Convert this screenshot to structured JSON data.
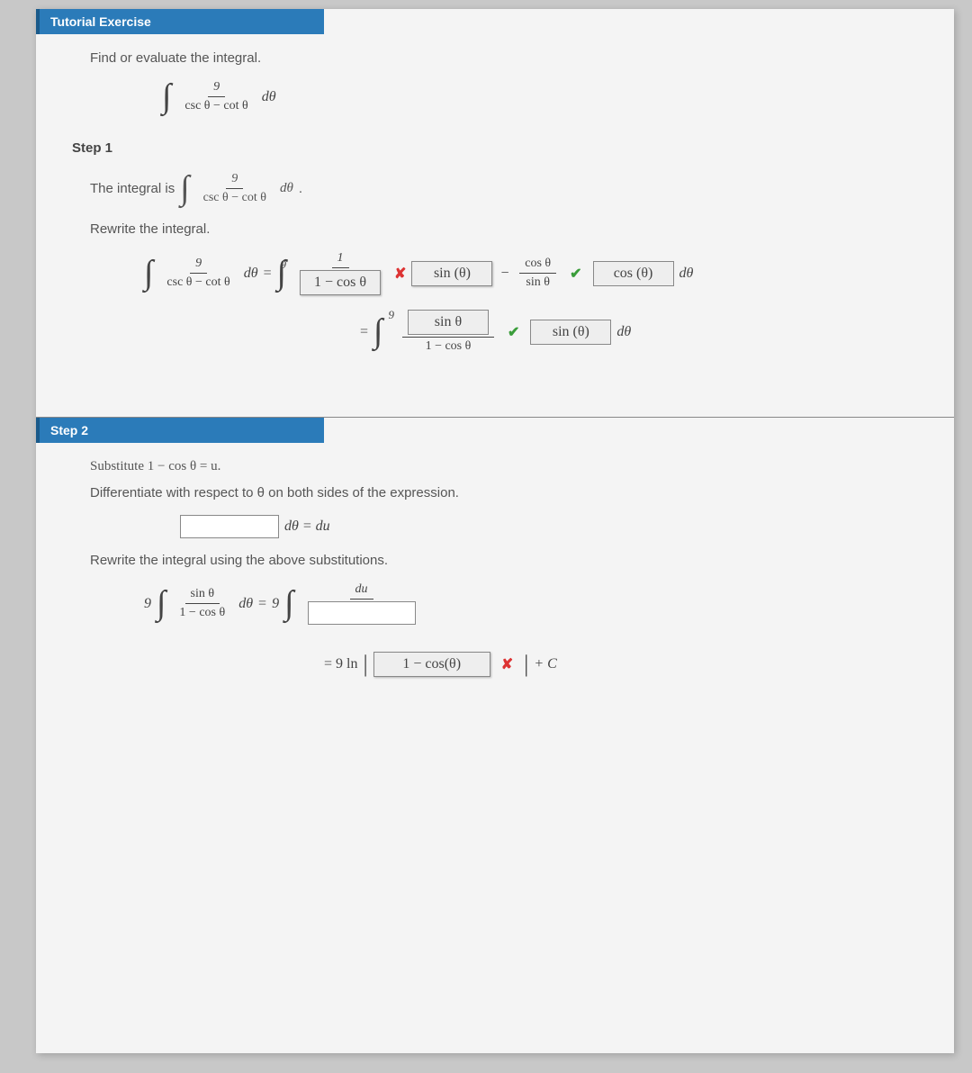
{
  "tutorial": {
    "header": "Tutorial Exercise",
    "prompt": "Find or evaluate the integral.",
    "integral_num": "9",
    "integral_den": "csc θ − cot θ",
    "dtheta": "dθ"
  },
  "step1": {
    "title": "Step 1",
    "intro_pre": "The integral is",
    "intro_period": ".",
    "rewrite": "Rewrite the integral.",
    "eq1": {
      "lhs_num": "9",
      "lhs_den": "csc θ − cot θ",
      "dtheta": "dθ",
      "equals": "=",
      "rhs_num": "1",
      "ans_den": "1 − cos θ",
      "wrong_sin": "sin (θ)",
      "minus": "−",
      "frac2_num": "cos θ",
      "frac2_den": "sin θ",
      "coef9": "9",
      "correct_cos": "cos (θ)",
      "dtheta2": "dθ"
    },
    "eq2": {
      "equals": "=",
      "coef9": "9",
      "ans_num": "sin θ",
      "den": "1 − cos θ",
      "correct_sin": "sin (θ)",
      "dtheta": "dθ"
    }
  },
  "step2": {
    "header": "Step 2",
    "substitute": "Substitute 1 − cos θ = u.",
    "differentiate": "Differentiate with respect to θ on both sides of the expression.",
    "dtheta_du": "dθ = du",
    "rewrite_sub": "Rewrite the integral using the above substitutions.",
    "coef9a": "9",
    "lhs_num": "sin θ",
    "lhs_den": "1 − cos θ",
    "dtheta": "dθ",
    "equals": "=",
    "coef9b": "9",
    "du": "du",
    "final_prefix": "= 9 ln",
    "final_ans": "1 − cos(θ)",
    "plus_c": "+ C"
  }
}
